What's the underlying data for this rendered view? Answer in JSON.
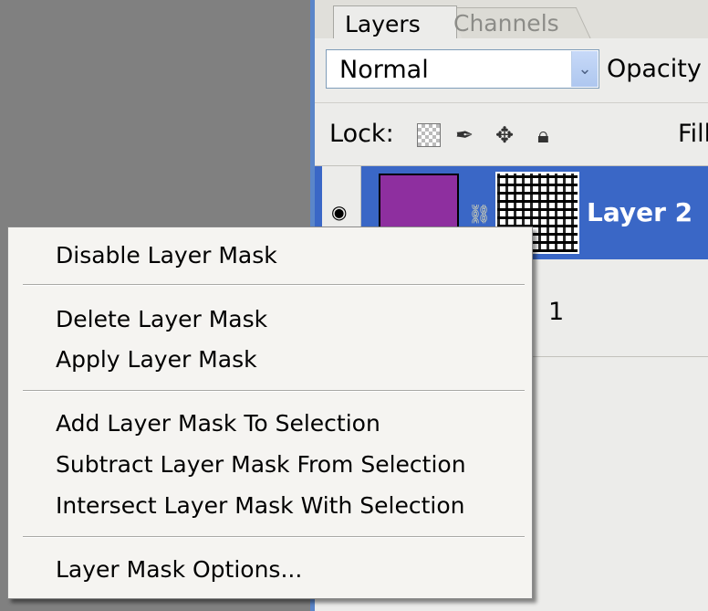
{
  "panel": {
    "tabs": [
      "Layers",
      "Channels"
    ],
    "blend_mode": "Normal",
    "opacity_label": "Opacity",
    "lock_label": "Lock:",
    "fill_label": "Fill",
    "accent_color": "#3a67c6"
  },
  "layers": [
    {
      "name": "Layer 2",
      "selected": true,
      "thumb_color": "#8e2f9f"
    },
    {
      "name": "1",
      "selected": false
    }
  ],
  "context_menu": {
    "groups": [
      [
        "Disable Layer Mask"
      ],
      [
        "Delete Layer Mask",
        "Apply Layer Mask"
      ],
      [
        "Add Layer Mask To Selection",
        "Subtract Layer Mask From Selection",
        "Intersect Layer Mask With Selection"
      ],
      [
        "Layer Mask Options..."
      ]
    ]
  }
}
